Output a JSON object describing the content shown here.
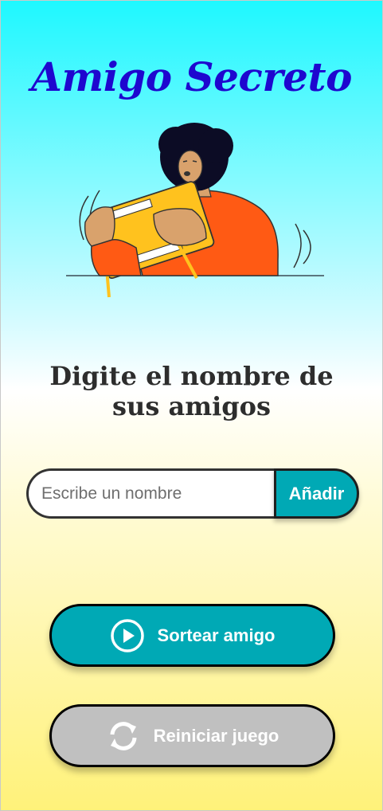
{
  "header": {
    "title": "Amigo Secreto"
  },
  "illustration": {
    "name": "person-playing-handheld-console"
  },
  "main": {
    "subtitle": "Digite el nombre de sus amigos",
    "input": {
      "placeholder": "Escribe un nombre",
      "value": ""
    },
    "add_label": "Añadir",
    "draw_label": "Sortear amigo",
    "reset_label": "Reiniciar juego"
  },
  "icons": {
    "draw": "play-circle-icon",
    "reset": "refresh-icon"
  },
  "colors": {
    "title": "#1e07cf",
    "accent": "#00a9b5",
    "disabled": "#c0c0c0"
  }
}
